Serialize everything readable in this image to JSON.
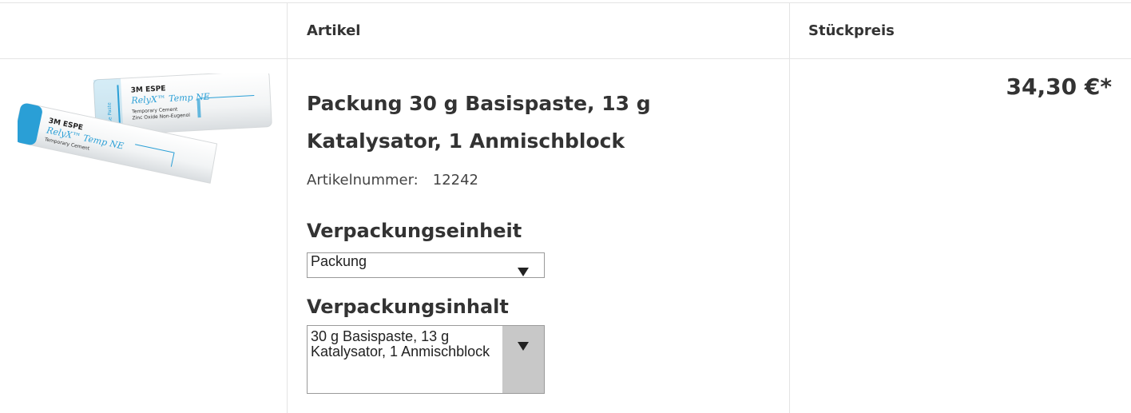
{
  "table": {
    "headers": {
      "article": "Artikel",
      "unit_price": "Stückpreis"
    }
  },
  "product": {
    "image": {
      "brand": "3M ESPE",
      "name": "RelyX™ Temp NE",
      "subtitle": "Temporary Cement",
      "subtitle2": "Zinc Oxide Non-Eugenol",
      "side_label": "Base Paste"
    },
    "title": "Packung 30 g Basispaste, 13 g Katalysator, 1 Anmischblock",
    "article_number_label": "Artikelnummer:",
    "article_number": "12242",
    "packaging_unit": {
      "label": "Verpackungseinheit",
      "selected": "Packung"
    },
    "packaging_content": {
      "label": "Verpackungsinhalt",
      "selected": "30 g Basispaste, 13 g Katalysator, 1 Anmischblock"
    },
    "price": "34,30 €*"
  },
  "colors": {
    "grid": "#e4e4e4",
    "tube_accent": "#2a9fd6",
    "select_arrow_bg": "#c8c8c8"
  }
}
